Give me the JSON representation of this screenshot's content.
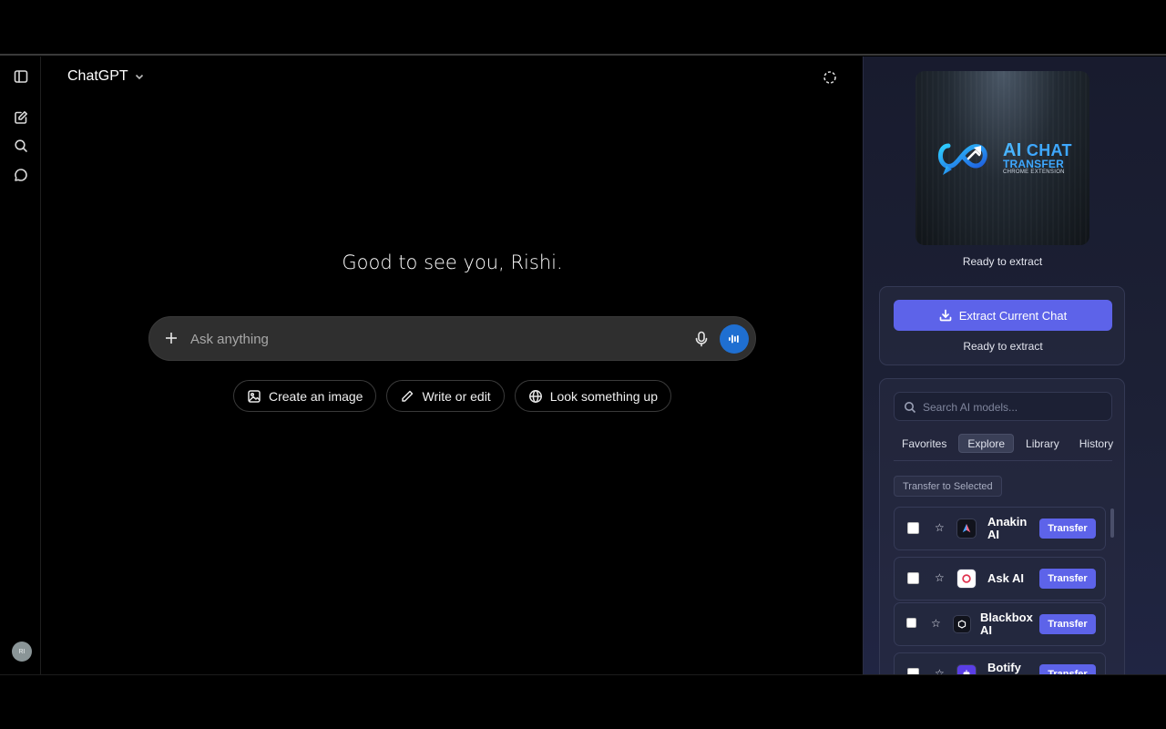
{
  "app": {
    "model_name": "ChatGPT",
    "greeting": "Good to see you, Rishi.",
    "avatar_initials": "RI",
    "composer": {
      "placeholder": "Ask anything"
    },
    "chips": [
      {
        "label": "Create an image",
        "icon": "image-icon"
      },
      {
        "label": "Write or edit",
        "icon": "pencil-icon"
      },
      {
        "label": "Look something up",
        "icon": "globe-icon"
      }
    ],
    "rail_icons": [
      "sidebar-toggle-icon",
      "new-chat-icon",
      "search-icon",
      "chat-bubble-icon"
    ]
  },
  "extension": {
    "logo": {
      "line1_ai": "AI",
      "line1_rest": "CHAT",
      "line2": "TRANSFER",
      "line3": "CHROME EXTENSION"
    },
    "status_top": "Ready to extract",
    "extract_button": "Extract Current Chat",
    "status_bottom": "Ready to extract",
    "search_placeholder": "Search AI models...",
    "tabs": [
      {
        "label": "Favorites",
        "active": false
      },
      {
        "label": "Explore",
        "active": true
      },
      {
        "label": "Library",
        "active": false
      },
      {
        "label": "History",
        "active": false
      }
    ],
    "transfer_selected": "Transfer to Selected",
    "models": [
      {
        "name": "Anakin AI",
        "button": "Transfer",
        "icon": "anakin-icon"
      },
      {
        "name": "Ask AI",
        "button": "Transfer",
        "icon": "ask-ai-icon"
      },
      {
        "name": "Blackbox AI",
        "button": "Transfer",
        "icon": "blackbox-icon"
      },
      {
        "name": "Botify",
        "button": "Transfer",
        "icon": "botify-icon"
      }
    ],
    "colors": {
      "accent": "#5d63e9",
      "voice_button": "#1f6fd1"
    }
  }
}
